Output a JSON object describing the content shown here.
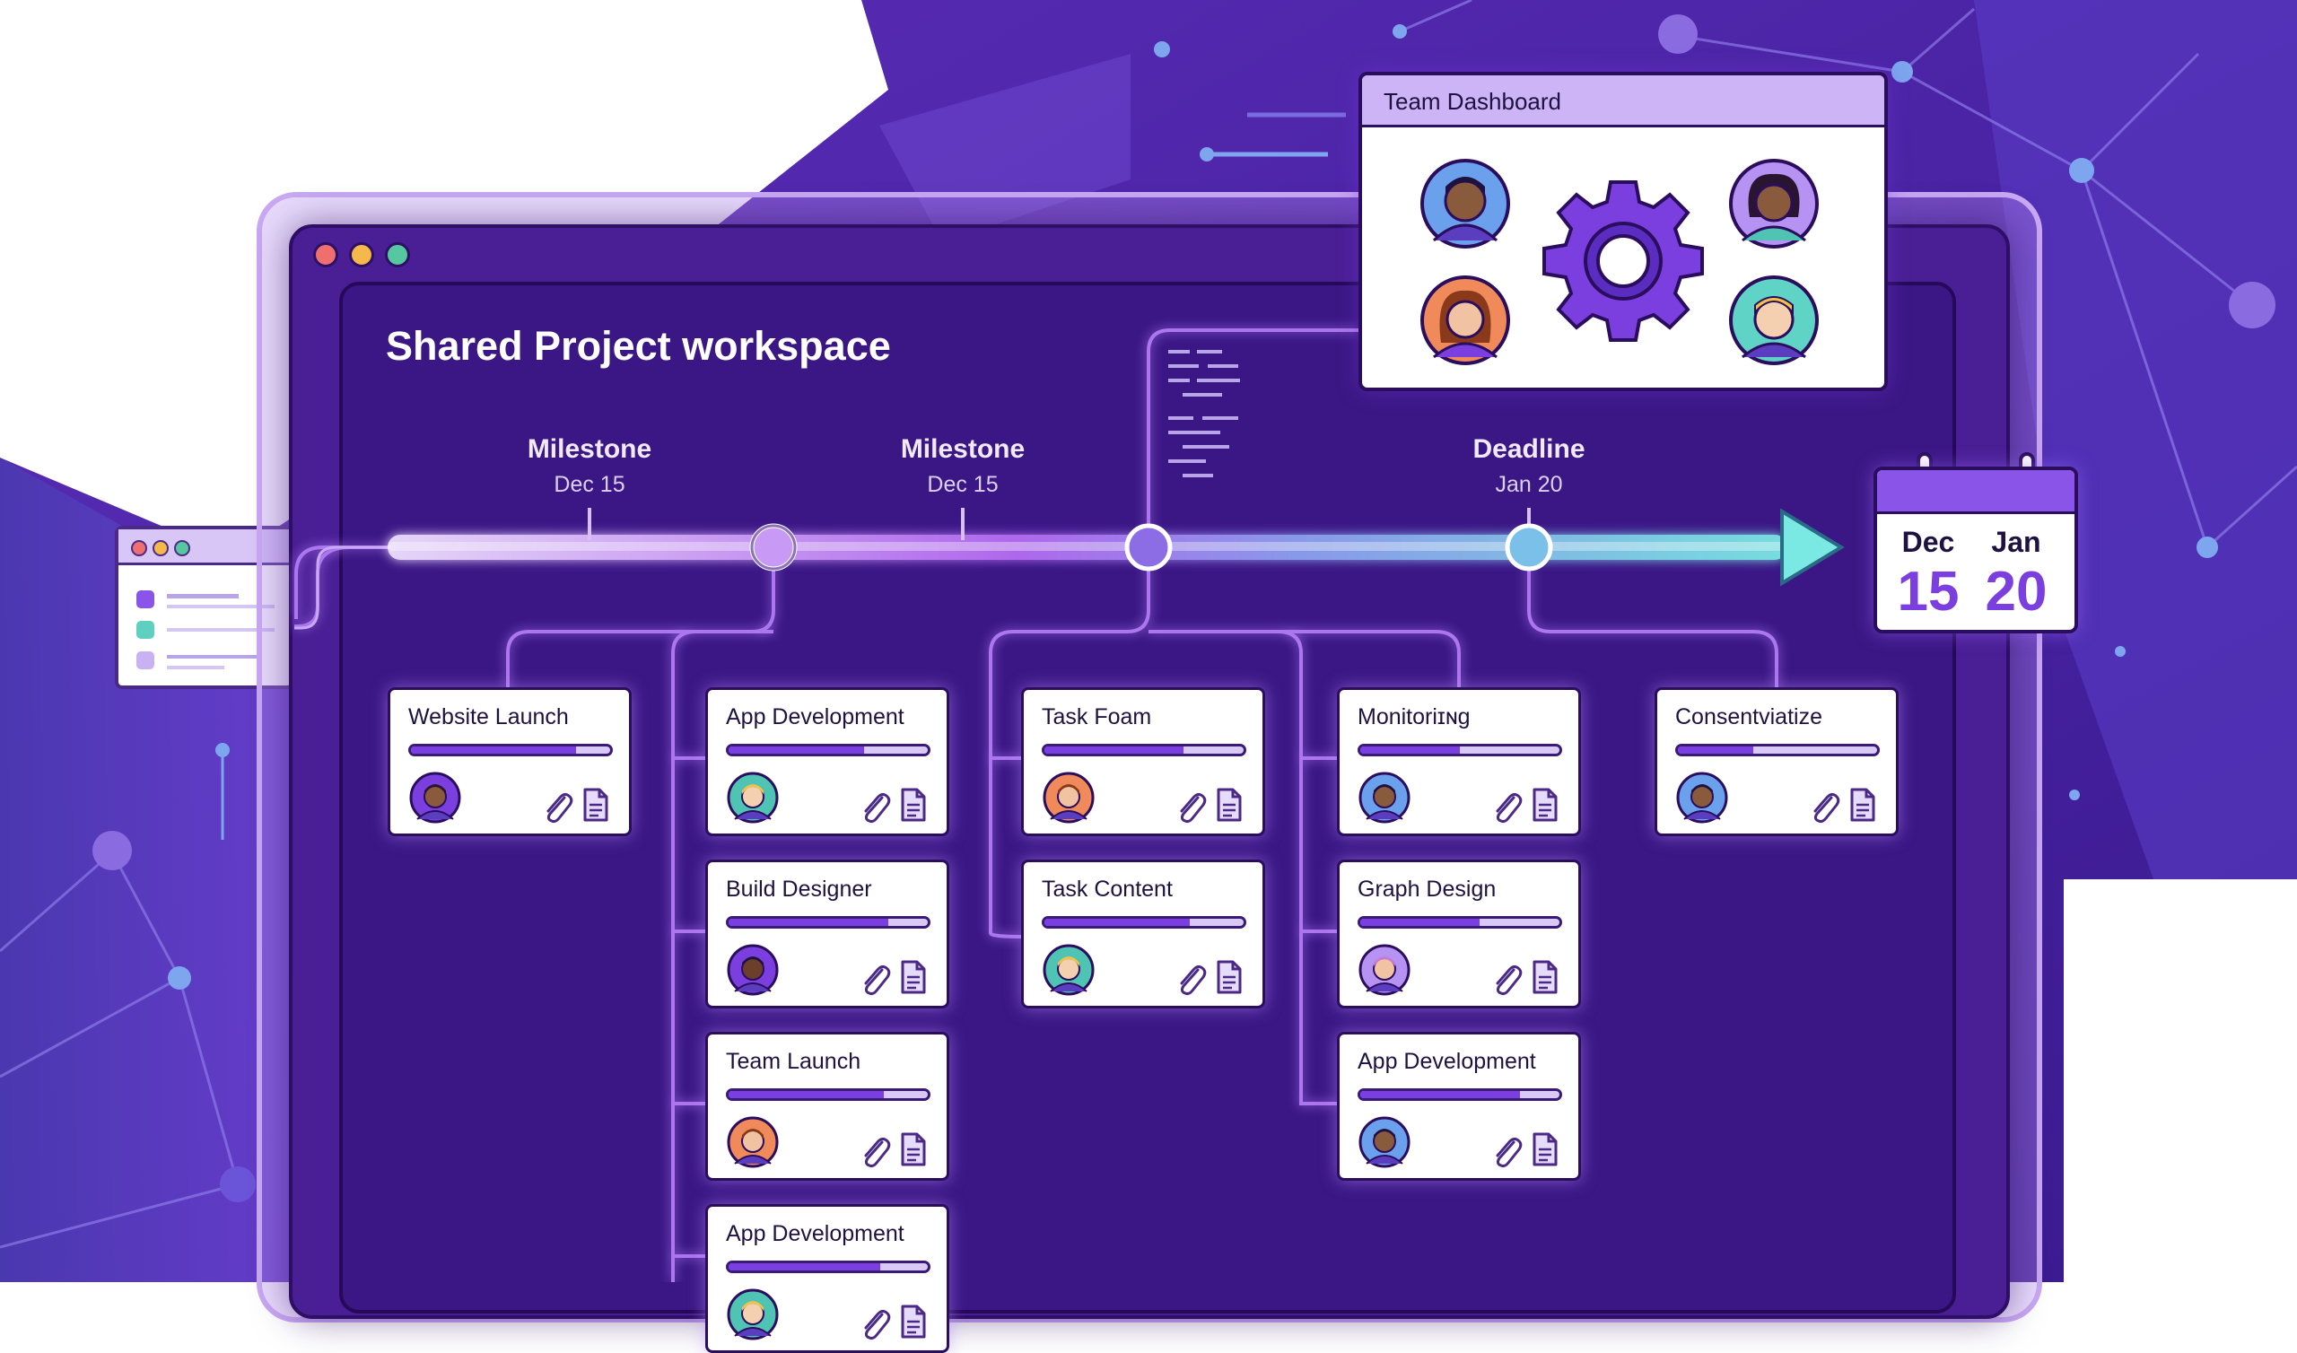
{
  "window": {
    "title": "Shared Project workspace"
  },
  "timeline": {
    "labels": [
      {
        "name": "Milestone",
        "date": "Dec 15"
      },
      {
        "name": "Milestone",
        "date": "Dec 15"
      },
      {
        "name": "Deadline",
        "date": "Jan 20"
      }
    ]
  },
  "dashboard": {
    "title": "Team Dashboard"
  },
  "calendar": {
    "month1": "Dec",
    "day1": "15",
    "month2": "Jan",
    "day2": "20"
  },
  "cards": [
    {
      "title": "Website Launch",
      "progress": 0.83
    },
    {
      "title": "App Development",
      "progress": 0.68
    },
    {
      "title": "Build Designer",
      "progress": 0.8
    },
    {
      "title": "Team Launch",
      "progress": 0.78
    },
    {
      "title": "App Development",
      "progress": 0.76
    },
    {
      "title": "Task Foam",
      "progress": 0.7
    },
    {
      "title": "Task Content",
      "progress": 0.73
    },
    {
      "title": "Monitoriɪɴg",
      "progress": 0.5
    },
    {
      "title": "Graph Design",
      "progress": 0.6
    },
    {
      "title": "App Development",
      "progress": 0.8
    },
    {
      "title": "Consentviatize",
      "progress": 0.38
    }
  ],
  "icons": {
    "attachment": "paperclip-icon",
    "document": "document-icon",
    "settings": "gear-icon",
    "calendar": "calendar-icon"
  },
  "colors": {
    "window_bg": "#4a1f95",
    "accent": "#7b3fe0",
    "timeline_end": "#5fd3d6",
    "node_fill": "#9b6be8"
  }
}
